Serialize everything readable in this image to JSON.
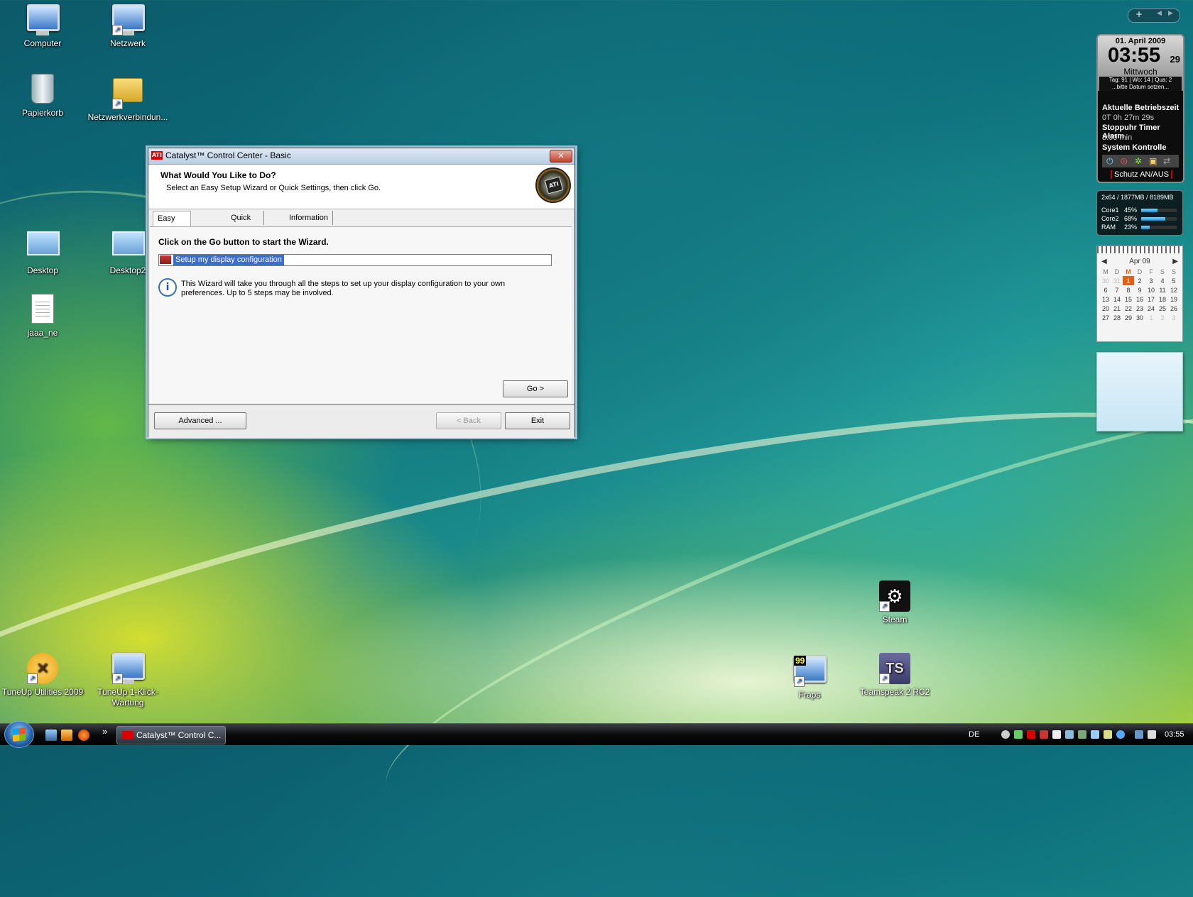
{
  "desktop_icons": {
    "computer": "Computer",
    "netzwerk": "Netzwerk",
    "papierkorb": "Papierkorb",
    "netzwerkverbindungen": "Netzwerkverbindun...",
    "desktop": "Desktop",
    "desktop2": "Desktop2",
    "jaaa_ne": "jaaa_ne",
    "steam": "Steam",
    "tuneup_utilities": "TuneUp Utilities 2009",
    "tuneup_wartung": "TuneUp 1-Klick-Wartung",
    "fraps": "Fraps",
    "fraps_badge": "99",
    "teamspeak": "Teamspeak 2 RC2"
  },
  "dialog": {
    "title": "Catalyst™ Control Center - Basic",
    "close_symbol": "✕",
    "heading": "What Would You Like to Do?",
    "subheading": "Select an Easy Setup Wizard or Quick Settings, then click Go.",
    "logo_text": "ATI",
    "tabs": [
      "Easy Setup Wizards",
      "Quick Settings",
      "Information Center"
    ],
    "lead": "Click on the Go button to start the Wizard.",
    "wizard_selected": "Setup my display configuration",
    "info_text": "This Wizard will take you through all the steps to set up your display configuration to your own preferences. Up to 5 steps may be involved.",
    "go_label": "Go >",
    "advanced_label": "Advanced ...",
    "back_label": "< Back",
    "exit_label": "Exit"
  },
  "taskbar": {
    "task_label": "Catalyst™ Control C...",
    "language": "DE",
    "time": "03:55",
    "chevron": "»"
  },
  "gadgets": {
    "clock": {
      "date": "01. April 2009",
      "time": "03:55",
      "seconds": "29",
      "weekday": "Mittwoch",
      "info_line1": "Tag: 91 | Wo: 14 | Qua: 2",
      "info_line2": "...bitte Datum setzen...",
      "uptime_label": "Aktuelle Betriebszeit",
      "uptime_value": "0T 0h 27m 29s",
      "timer_label": "Stoppuhr Timer Alarm",
      "timer_value": "3:00 min",
      "system_label": "System Kontrolle",
      "schutz_label": "Schutz AN/AUS"
    },
    "cpu": {
      "header": "2x64 / 1877MB / 8189MB",
      "rows": [
        {
          "name": "Core1",
          "pct": "45%",
          "value": 45
        },
        {
          "name": "Core2",
          "pct": "68%",
          "value": 68
        },
        {
          "name": "RAM",
          "pct": "23%",
          "value": 23
        }
      ]
    },
    "calendar": {
      "month": "Apr 09",
      "prev": "◀",
      "next": "▶",
      "weekdays": [
        "M",
        "D",
        "M",
        "D",
        "F",
        "S",
        "S"
      ],
      "today": "1"
    }
  },
  "colors": {
    "accent_selection": "#3a6fd0",
    "ati_red": "#dd0000",
    "calendar_today": "#e26010"
  }
}
